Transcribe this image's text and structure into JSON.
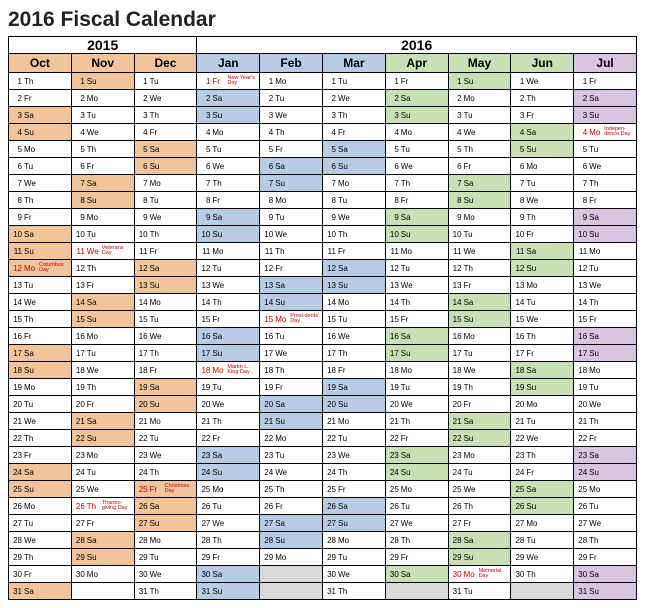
{
  "title": "2016 Fiscal Calendar",
  "years": {
    "y2015": "2015",
    "y2016": "2016"
  },
  "months": [
    "Oct",
    "Nov",
    "Dec",
    "Jan",
    "Feb",
    "Mar",
    "Apr",
    "May",
    "Jun",
    "Jul"
  ],
  "month_bg": [
    "bg-orange",
    "bg-orange",
    "bg-orange",
    "bg-blue",
    "bg-blue",
    "bg-blue",
    "bg-green",
    "bg-green",
    "bg-green",
    "bg-purple"
  ],
  "days": [
    [
      "Th",
      "Su",
      "Tu",
      "Fr",
      "Mo",
      "Tu",
      "Fr",
      "Su",
      "We",
      "Fr"
    ],
    [
      "Fr",
      "Mo",
      "We",
      "Sa",
      "Tu",
      "We",
      "Sa",
      "Mo",
      "Th",
      "Sa"
    ],
    [
      "Sa",
      "Tu",
      "Th",
      "Su",
      "We",
      "Th",
      "Su",
      "Tu",
      "Fr",
      "Su"
    ],
    [
      "Su",
      "We",
      "Fr",
      "Mo",
      "Th",
      "Fr",
      "Mo",
      "We",
      "Sa",
      "Mo"
    ],
    [
      "Mo",
      "Th",
      "Sa",
      "Tu",
      "Fr",
      "Sa",
      "Tu",
      "Th",
      "Su",
      "Tu"
    ],
    [
      "Tu",
      "Fr",
      "Su",
      "We",
      "Sa",
      "Su",
      "We",
      "Fr",
      "Mo",
      "We"
    ],
    [
      "We",
      "Sa",
      "Mo",
      "Th",
      "Su",
      "Mo",
      "Th",
      "Sa",
      "Tu",
      "Th"
    ],
    [
      "Th",
      "Su",
      "Tu",
      "Fr",
      "Mo",
      "Tu",
      "Fr",
      "Su",
      "We",
      "Fr"
    ],
    [
      "Fr",
      "Mo",
      "We",
      "Sa",
      "Tu",
      "We",
      "Sa",
      "Mo",
      "Th",
      "Sa"
    ],
    [
      "Sa",
      "Tu",
      "Th",
      "Su",
      "We",
      "Th",
      "Su",
      "Tu",
      "Fr",
      "Su"
    ],
    [
      "Su",
      "We",
      "Fr",
      "Mo",
      "Th",
      "Fr",
      "Mo",
      "We",
      "Sa",
      "Mo"
    ],
    [
      "Mo",
      "Th",
      "Sa",
      "Tu",
      "Fr",
      "Sa",
      "Tu",
      "Th",
      "Su",
      "Tu"
    ],
    [
      "Tu",
      "Fr",
      "Su",
      "We",
      "Sa",
      "Su",
      "We",
      "Fr",
      "Mo",
      "We"
    ],
    [
      "We",
      "Sa",
      "Mo",
      "Th",
      "Su",
      "Mo",
      "Th",
      "Sa",
      "Tu",
      "Th"
    ],
    [
      "Th",
      "Su",
      "Tu",
      "Fr",
      "Mo",
      "Tu",
      "Fr",
      "Su",
      "We",
      "Fr"
    ],
    [
      "Fr",
      "Mo",
      "We",
      "Sa",
      "Tu",
      "We",
      "Sa",
      "Mo",
      "Th",
      "Sa"
    ],
    [
      "Sa",
      "Tu",
      "Th",
      "Su",
      "We",
      "Th",
      "Su",
      "Tu",
      "Fr",
      "Su"
    ],
    [
      "Su",
      "We",
      "Fr",
      "Mo",
      "Th",
      "Fr",
      "Mo",
      "We",
      "Sa",
      "Mo"
    ],
    [
      "Mo",
      "Th",
      "Sa",
      "Tu",
      "Fr",
      "Sa",
      "Tu",
      "Th",
      "Su",
      "Tu"
    ],
    [
      "Tu",
      "Fr",
      "Su",
      "We",
      "Sa",
      "Su",
      "We",
      "Fr",
      "Mo",
      "We"
    ],
    [
      "We",
      "Sa",
      "Mo",
      "Th",
      "Su",
      "Mo",
      "Th",
      "Sa",
      "Tu",
      "Th"
    ],
    [
      "Th",
      "Su",
      "Tu",
      "Fr",
      "Mo",
      "Tu",
      "Fr",
      "Su",
      "We",
      "Fr"
    ],
    [
      "Fr",
      "Mo",
      "We",
      "Sa",
      "Tu",
      "We",
      "Sa",
      "Mo",
      "Th",
      "Sa"
    ],
    [
      "Sa",
      "Tu",
      "Th",
      "Su",
      "We",
      "Th",
      "Su",
      "Tu",
      "Fr",
      "Su"
    ],
    [
      "Su",
      "We",
      "Fr",
      "Mo",
      "Th",
      "Fr",
      "Mo",
      "We",
      "Sa",
      "Mo"
    ],
    [
      "Mo",
      "Th",
      "Sa",
      "Tu",
      "Fr",
      "Sa",
      "Tu",
      "Th",
      "Su",
      "Tu"
    ],
    [
      "Tu",
      "Fr",
      "Su",
      "We",
      "Sa",
      "Su",
      "We",
      "Fr",
      "Mo",
      "We"
    ],
    [
      "We",
      "Sa",
      "Mo",
      "Th",
      "Su",
      "Mo",
      "Th",
      "Sa",
      "Tu",
      "Th"
    ],
    [
      "Th",
      "Su",
      "Tu",
      "Fr",
      "Mo",
      "Tu",
      "Fr",
      "Su",
      "We",
      "Fr"
    ],
    [
      "Fr",
      "Mo",
      "We",
      "Sa",
      "",
      "We",
      "Sa",
      "Mo",
      "Th",
      "Sa"
    ],
    [
      "Sa",
      "",
      "Th",
      "Su",
      "",
      "Th",
      "",
      "Tu",
      "",
      "Su"
    ]
  ],
  "holidays": {
    "1,3": "New Year's Day",
    "4,9": "Indepen-dence Day",
    "11,1": "Veterans Day",
    "12,0": "Columbus Day",
    "15,4": "Presi-dents' Day",
    "18,3": "Martin L. King Day",
    "25,2": "Christmas Day",
    "26,1": "Thanks-giving Day",
    "30,7": "Memorial Day"
  },
  "colors": {
    "0": {
      "3": "o",
      "4": "o",
      "10": "o",
      "11": "o",
      "12": "o-r",
      "17": "o",
      "18": "o",
      "24": "o",
      "25": "o",
      "31": "o"
    },
    "1": {
      "1": "o",
      "7": "o",
      "8": "o",
      "11": "r",
      "14": "o",
      "15": "o",
      "21": "o",
      "22": "o",
      "26": "r",
      "28": "o",
      "29": "o"
    },
    "2": {
      "5": "o",
      "6": "o",
      "12": "o",
      "13": "o",
      "19": "o",
      "20": "o",
      "25": "o-r",
      "26": "o",
      "27": "o"
    },
    "3": {
      "1": "r",
      "2": "b",
      "3": "b",
      "9": "b",
      "10": "b",
      "16": "b",
      "17": "b",
      "18": "r",
      "23": "b",
      "24": "b",
      "30": "b",
      "31": "b"
    },
    "4": {
      "6": "b",
      "7": "b",
      "13": "b",
      "14": "b",
      "15": "r",
      "20": "b",
      "21": "b",
      "27": "b",
      "28": "b",
      "30": "x",
      "31": "x"
    },
    "5": {
      "5": "b",
      "6": "b",
      "12": "b",
      "13": "b",
      "19": "b",
      "20": "b",
      "26": "b",
      "27": "b"
    },
    "6": {
      "2": "g",
      "3": "g",
      "9": "g",
      "10": "g",
      "16": "g",
      "17": "g",
      "23": "g",
      "24": "g",
      "30": "g",
      "31": "x"
    },
    "7": {
      "1": "g",
      "7": "g",
      "8": "g",
      "14": "g",
      "15": "g",
      "21": "g",
      "22": "g",
      "28": "g",
      "29": "g",
      "30": "r"
    },
    "8": {
      "4": "g",
      "5": "g",
      "11": "g",
      "12": "g",
      "18": "g",
      "19": "g",
      "25": "g",
      "26": "g",
      "31": "x"
    },
    "9": {
      "2": "p",
      "3": "p",
      "4": "r",
      "9": "p",
      "10": "p",
      "16": "p",
      "17": "p",
      "23": "p",
      "24": "p",
      "30": "p",
      "31": "p"
    }
  }
}
